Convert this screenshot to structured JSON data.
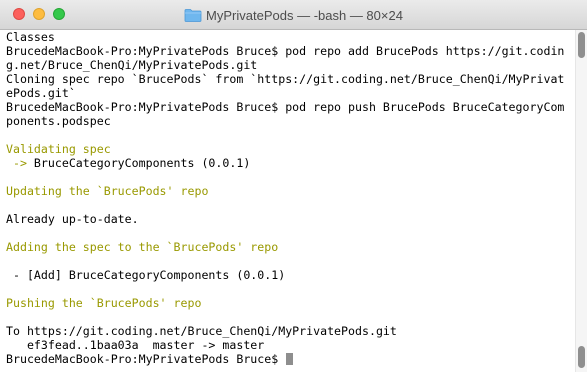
{
  "window": {
    "title": "MyPrivatePods — -bash — 80×24",
    "folder_icon": "folder-icon",
    "close_icon": "close-icon",
    "minimize_icon": "minimize-icon",
    "zoom_icon": "zoom-icon",
    "colors": {
      "close": "#fc605c",
      "minimize": "#fdbc40",
      "zoom": "#34c84a",
      "output_highlight": "#999900"
    }
  },
  "terminal": {
    "lines": [
      {
        "text": "Classes",
        "color": "default"
      },
      {
        "text": "BrucedeMacBook-Pro:MyPrivatePods Bruce$ pod repo add BrucePods https://git.codin",
        "color": "default"
      },
      {
        "text": "g.net/Bruce_ChenQi/MyPrivatePods.git",
        "color": "default"
      },
      {
        "text": "Cloning spec repo `BrucePods` from `https://git.coding.net/Bruce_ChenQi/MyPrivat",
        "color": "default"
      },
      {
        "text": "ePods.git`",
        "color": "default"
      },
      {
        "text": "BrucedeMacBook-Pro:MyPrivatePods Bruce$ pod repo push BrucePods BruceCategoryCom",
        "color": "default"
      },
      {
        "text": "ponents.podspec",
        "color": "default"
      },
      {
        "text": "",
        "color": "default"
      },
      {
        "text": "Validating spec",
        "color": "yellow"
      },
      {
        "text": " -> BruceCategoryComponents (0.0.1)",
        "color": "mixed"
      },
      {
        "text": "",
        "color": "default"
      },
      {
        "text": "Updating the `BrucePods' repo",
        "color": "yellow"
      },
      {
        "text": "",
        "color": "default"
      },
      {
        "text": "Already up-to-date.",
        "color": "default"
      },
      {
        "text": "",
        "color": "default"
      },
      {
        "text": "Adding the spec to the `BrucePods' repo",
        "color": "yellow"
      },
      {
        "text": "",
        "color": "default"
      },
      {
        "text": " - [Add] BruceCategoryComponents (0.0.1)",
        "color": "default"
      },
      {
        "text": "",
        "color": "default"
      },
      {
        "text": "Pushing the `BrucePods' repo",
        "color": "yellow"
      },
      {
        "text": "",
        "color": "default"
      },
      {
        "text": "To https://git.coding.net/Bruce_ChenQi/MyPrivatePods.git",
        "color": "default"
      },
      {
        "text": "   ef3fead..1baa03a  master -> master",
        "color": "default"
      }
    ],
    "arrow_prefix": " -> ",
    "arrow_rest": "BruceCategoryComponents (0.0.1)",
    "prompt": "BrucedeMacBook-Pro:MyPrivatePods Bruce$ ",
    "cursor_icon": "block-cursor-icon"
  }
}
